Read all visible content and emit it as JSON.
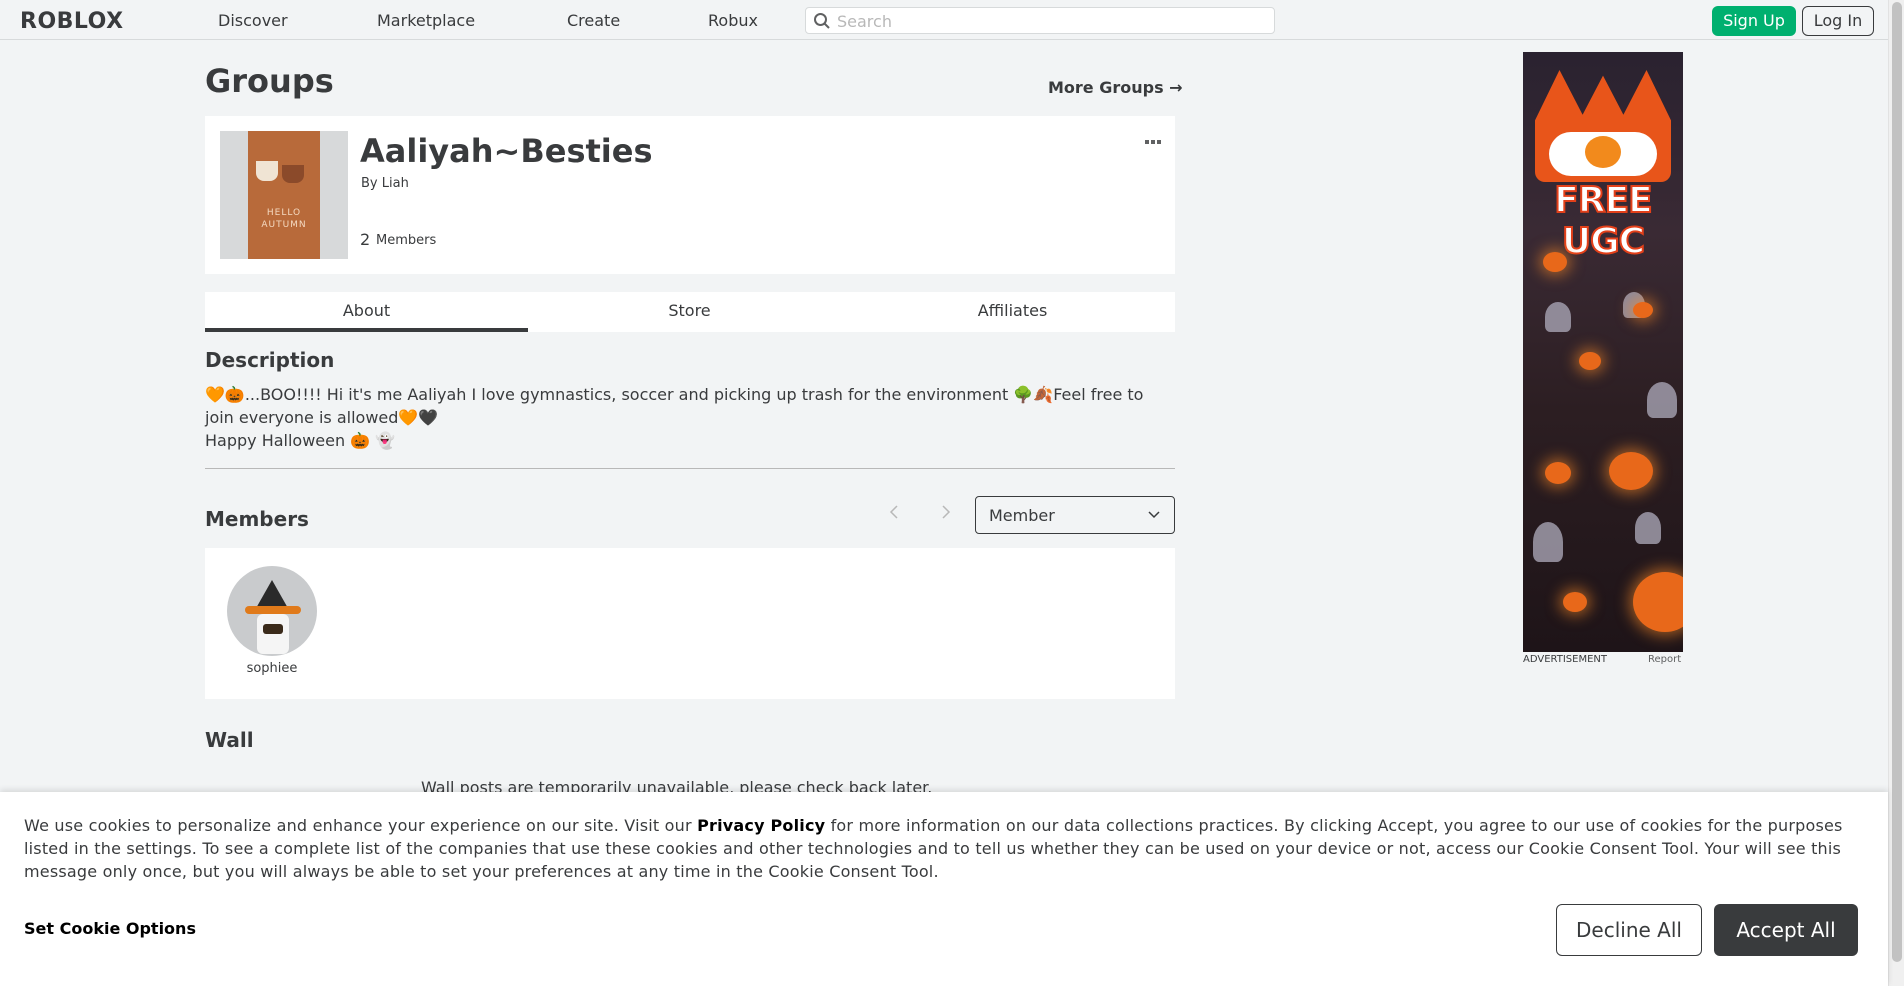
{
  "nav": {
    "logo": "ROBLOX",
    "links": [
      "Discover",
      "Marketplace",
      "Create",
      "Robux"
    ],
    "search_placeholder": "Search",
    "signup_label": "Sign Up",
    "login_label": "Log In"
  },
  "page": {
    "title": "Groups",
    "more_groups": "More Groups →"
  },
  "group": {
    "name": "Aaliyah~Besties",
    "by_prefix": "By",
    "owner": "Liah",
    "member_count": "2",
    "member_label": "Members",
    "thumbnail_text": "HELLO AUTUMN",
    "menu_icon": "ellipsis-icon"
  },
  "tabs": [
    "About",
    "Store",
    "Affiliates"
  ],
  "about": {
    "description_title": "Description",
    "description_line1": "🧡🎃...BOO!!!! Hi it's me Aaliyah I love gymnastics, soccer and picking up trash for the environment 🌳🍂Feel free to join everyone is allowed🧡🖤",
    "description_line2": "Happy Halloween 🎃 👻"
  },
  "members": {
    "title": "Members",
    "prev_icon": "chevron-left-icon",
    "next_icon": "chevron-right-icon",
    "role_selected": "Member",
    "list": [
      {
        "name": "sophiee"
      }
    ]
  },
  "wall": {
    "title": "Wall",
    "message": "Wall posts are temporarily unavailable, please check back later."
  },
  "ad": {
    "headline": "FREE UGC",
    "label": "ADVERTISEMENT",
    "report": "Report"
  },
  "cookie": {
    "text_before": "We use cookies to personalize and enhance your experience on our site. Visit our",
    "privacy_link": "Privacy Policy",
    "text_after": "for more information on our data collections practices. By clicking Accept, you agree to our use of cookies for the purposes listed in the settings. To see a complete list of the companies that use these cookies and other technologies and to tell us whether they can be used on your device or not, access our Cookie Consent Tool. Your will see this message only once, but you will always be able to set your preferences at any time in the Cookie Consent Tool.",
    "options_label": "Set Cookie Options",
    "decline_label": "Decline All",
    "accept_label": "Accept All"
  },
  "colors": {
    "signup_green": "#00b06f",
    "text_dark": "#393b3d",
    "background": "#f2f4f5"
  }
}
